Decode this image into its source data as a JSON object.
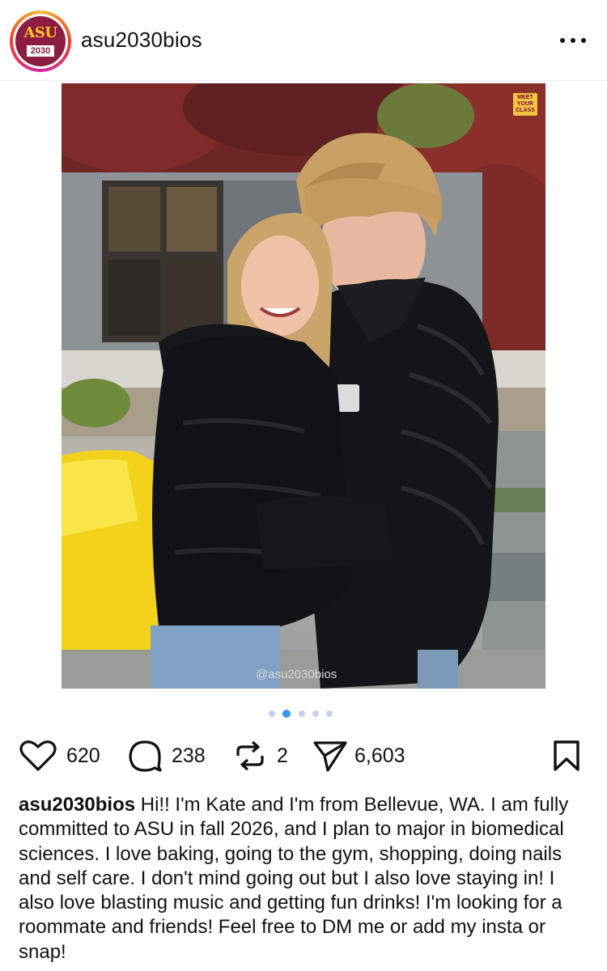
{
  "header": {
    "avatar_logo": "ASU",
    "avatar_year": "2030",
    "username": "asu2030bios",
    "more_icon": "more-dots-icon"
  },
  "post": {
    "image_badge": [
      "MEET",
      "YOUR",
      "CLASS"
    ],
    "watermark": "@asu2030bios",
    "carousel": {
      "total": 5,
      "active_index": 1
    }
  },
  "actions": {
    "likes": "620",
    "comments": "238",
    "reposts": "2",
    "shares": "6,603",
    "icons": [
      "heart-icon",
      "comment-icon",
      "repost-icon",
      "share-icon",
      "bookmark-icon"
    ]
  },
  "caption": {
    "username": "asu2030bios",
    "text": "Hi!! I'm Kate and I'm from Bellevue, WA. I am fully committed to ASU in fall 2026, and I plan to major in biomedical sciences. I love baking, going to the gym, shopping, doing nails and self care. I don't mind going out but I also love staying in! I also love blasting music and getting fun drinks! I'm looking for a roommate and friends! Feel free to DM me or add my insta or snap!"
  },
  "colors": {
    "asu_maroon": "#8c1d40",
    "asu_gold": "#ffc627",
    "carousel_active": "#3897f0",
    "text": "#111111"
  }
}
